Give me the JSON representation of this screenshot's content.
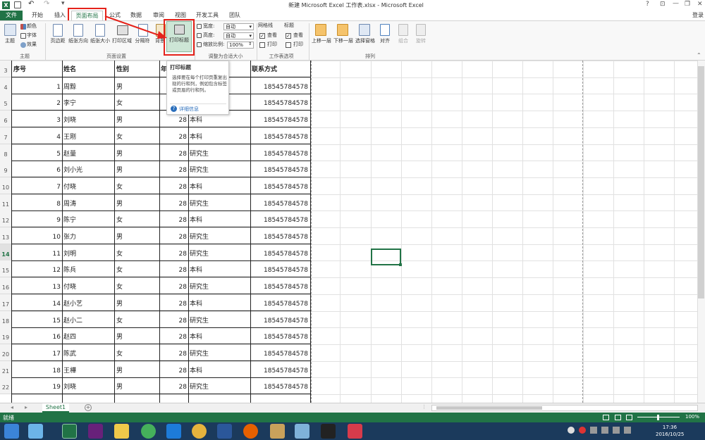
{
  "window": {
    "title": "新建 Microsoft Excel 工作表.xlsx - Microsoft Excel",
    "help": "?",
    "minimize": "—",
    "restore": "❐",
    "close": "✕",
    "signin": "登录"
  },
  "tabs": [
    "文件",
    "开始",
    "插入",
    "页面布局",
    "公式",
    "数据",
    "审阅",
    "视图",
    "开发工具",
    "团队"
  ],
  "ribbon": {
    "theme": {
      "themes": "主题",
      "colors": "颜色",
      "fonts": "字体",
      "effects": "效果",
      "group": "主题"
    },
    "page_setup": {
      "margins": "页边距",
      "orientation": "纸张方向",
      "size": "纸张大小",
      "print_area": "打印区域",
      "breaks": "分隔符",
      "background": "背景",
      "print_titles": "打印标题",
      "group": "页面设置"
    },
    "scale": {
      "width_label": "宽度:",
      "width_value": "自动",
      "height_label": "高度:",
      "height_value": "自动",
      "scale_label": "缩放比例:",
      "scale_value": "100%",
      "group": "调整为合适大小"
    },
    "sheet_options": {
      "gridlines": "网格线",
      "headings": "标题",
      "view1": "查看",
      "print1": "打印",
      "view2": "查看",
      "print2": "打印",
      "group": "工作表选项"
    },
    "arrange": {
      "bring_forward": "上移一层",
      "send_backward": "下移一层",
      "selection_pane": "选择窗格",
      "align": "对齐",
      "group_btn": "组合",
      "rotate": "旋转",
      "group": "排列"
    }
  },
  "tooltip": {
    "title": "打印标题",
    "body": "选择要在每个打印页重复出现的行和列，例如包含标签或页眉的行和列。",
    "more": "详细信息"
  },
  "table": {
    "headers": [
      "序号",
      "姓名",
      "性别",
      "年龄",
      "",
      "联系方式"
    ],
    "rows": [
      [
        "1",
        "周黥",
        "男",
        "",
        "",
        "18545784578"
      ],
      [
        "2",
        "李宁",
        "女",
        "",
        "",
        "18545784578"
      ],
      [
        "3",
        "刘晓",
        "男",
        "28",
        "本科",
        "18545784578"
      ],
      [
        "4",
        "王刚",
        "女",
        "28",
        "本科",
        "18545784578"
      ],
      [
        "5",
        "赵量",
        "男",
        "28",
        "研究生",
        "18545784578"
      ],
      [
        "6",
        "刘小光",
        "男",
        "28",
        "研究生",
        "18545784578"
      ],
      [
        "7",
        "付晓",
        "女",
        "28",
        "本科",
        "18545784578"
      ],
      [
        "8",
        "周涛",
        "男",
        "28",
        "研究生",
        "18545784578"
      ],
      [
        "9",
        "陈宁",
        "女",
        "28",
        "本科",
        "18545784578"
      ],
      [
        "10",
        "张力",
        "男",
        "28",
        "研究生",
        "18545784578"
      ],
      [
        "11",
        "刘明",
        "女",
        "28",
        "研究生",
        "18545784578"
      ],
      [
        "12",
        "陈兵",
        "女",
        "28",
        "本科",
        "18545784578"
      ],
      [
        "13",
        "付晓",
        "女",
        "28",
        "研究生",
        "18545784578"
      ],
      [
        "14",
        "赵小艺",
        "男",
        "28",
        "本科",
        "18545784578"
      ],
      [
        "15",
        "赵小二",
        "女",
        "28",
        "研究生",
        "18545784578"
      ],
      [
        "16",
        "赵四",
        "男",
        "28",
        "本科",
        "18545784578"
      ],
      [
        "17",
        "陈武",
        "女",
        "28",
        "研究生",
        "18545784578"
      ],
      [
        "18",
        "王樺",
        "男",
        "28",
        "本科",
        "18545784578"
      ],
      [
        "19",
        "刘晓",
        "男",
        "28",
        "研究生",
        "18545784578"
      ]
    ],
    "row_numbers": [
      "3",
      "4",
      "5",
      "6",
      "7",
      "8",
      "9",
      "10",
      "11",
      "12",
      "13",
      "14",
      "15",
      "16",
      "17",
      "18",
      "19",
      "20",
      "21",
      "22"
    ]
  },
  "sheet_tab": "Sheet1",
  "status": {
    "ready": "就绪",
    "zoom": "100%"
  },
  "clock": {
    "time": "17:36",
    "date": "2016/10/25"
  },
  "colors": {
    "excel_green": "#217346",
    "highlight_red": "#e5231b"
  }
}
